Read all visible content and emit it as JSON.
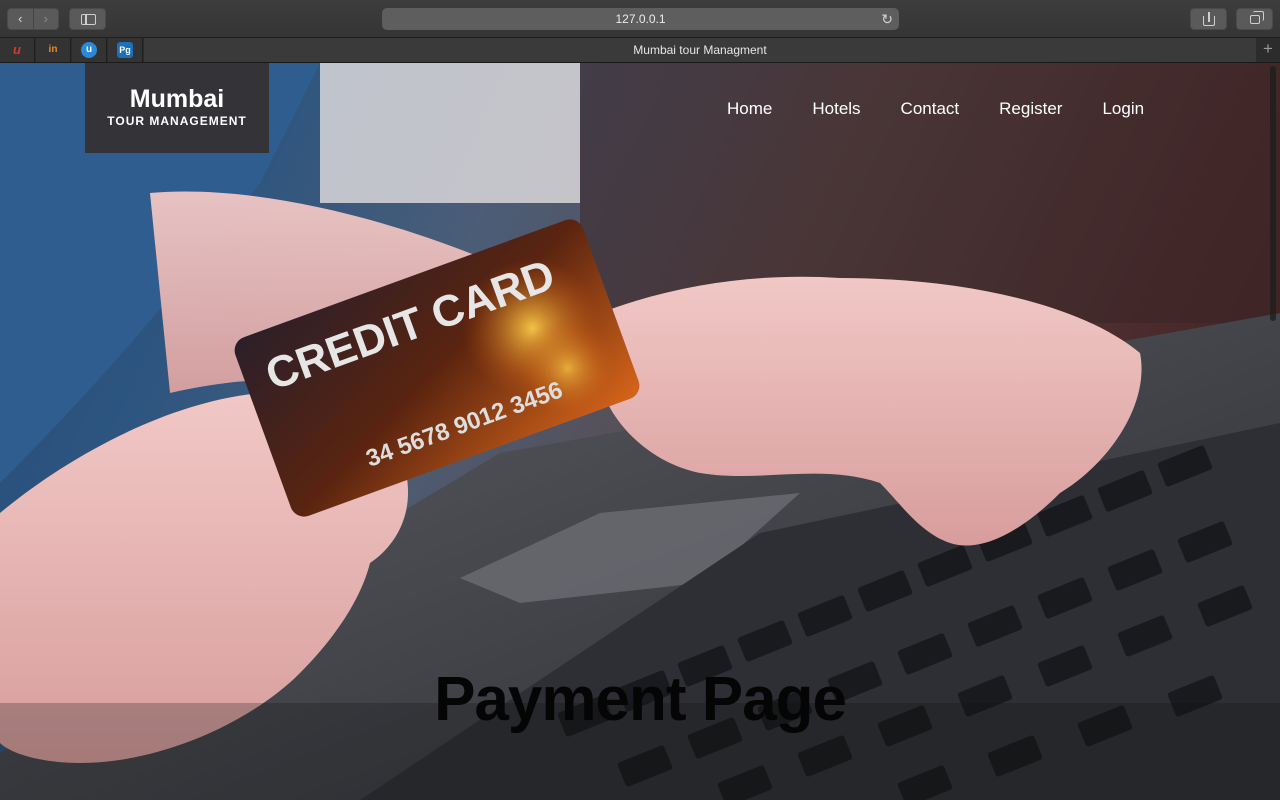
{
  "browser": {
    "url": "127.0.0.1",
    "tab_title": "Mumbai tour Managment",
    "pinned_tabs": [
      {
        "icon": "red-brand-icon",
        "glyph": "u"
      },
      {
        "icon": "orange-in-icon",
        "glyph": "in"
      },
      {
        "icon": "blue-circle-icon",
        "glyph": "u"
      },
      {
        "icon": "pg-icon",
        "glyph": "Pg"
      }
    ]
  },
  "site": {
    "brand_main": "Mumbai",
    "brand_sub": "TOUR MANAGEMENT",
    "nav": [
      "Home",
      "Hotels",
      "Contact",
      "Register",
      "Login"
    ],
    "hero_image_text": {
      "card_label": "CREDIT CARD",
      "card_number": "34 5678 9012 3456"
    },
    "heading": "Payment Page"
  }
}
